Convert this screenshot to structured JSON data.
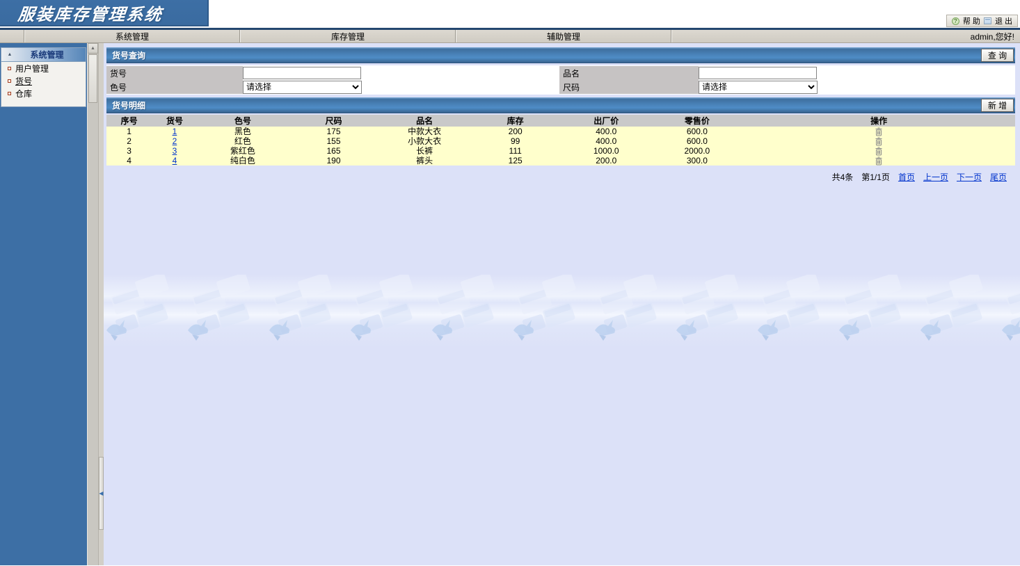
{
  "app": {
    "title": "服装库存管理系统"
  },
  "topbar": {
    "help": "帮 助",
    "exit": "退 出"
  },
  "menubar": {
    "items": [
      "系统管理",
      "库存管理",
      "辅助管理"
    ],
    "welcome": "admin,您好!"
  },
  "sidebar": {
    "header": "系统管理",
    "items": [
      {
        "label": "用户管理",
        "active": false
      },
      {
        "label": "货号",
        "active": true
      },
      {
        "label": "仓库",
        "active": false
      }
    ]
  },
  "query": {
    "title": "货号查询",
    "search_button": "查 询",
    "huohao_label": "货号",
    "pinming_label": "品名",
    "sehao_label": "色号",
    "chima_label": "尺码",
    "huohao_value": "",
    "pinming_value": "",
    "sehao_select": "请选择",
    "chima_select": "请选择"
  },
  "detail": {
    "title": "货号明细",
    "add_button": "新 增",
    "columns": [
      "序号",
      "货号",
      "色号",
      "尺码",
      "品名",
      "库存",
      "出厂价",
      "零售价",
      "操作"
    ],
    "rows": [
      [
        "1",
        "1",
        "黑色",
        "175",
        "中款大衣",
        "200",
        "400.0",
        "600.0"
      ],
      [
        "2",
        "2",
        "红色",
        "155",
        "小款大衣",
        "99",
        "400.0",
        "600.0"
      ],
      [
        "3",
        "3",
        "紫红色",
        "165",
        "长裤",
        "111",
        "1000.0",
        "2000.0"
      ],
      [
        "4",
        "4",
        "纯白色",
        "190",
        "裤头",
        "125",
        "200.0",
        "300.0"
      ]
    ],
    "action_icon": "trash-icon"
  },
  "pagination": {
    "total": "共4条",
    "page": "第1/1页",
    "first": "首页",
    "prev": "上一页",
    "next": "下一页",
    "last": "尾页"
  },
  "colors": {
    "sidebar_blue": "#3d6fa5",
    "content_bg": "#dce1f8",
    "row_yellow": "#ffffcc",
    "link_blue": "#0033cc",
    "bar_blue": "#4a84bb"
  }
}
